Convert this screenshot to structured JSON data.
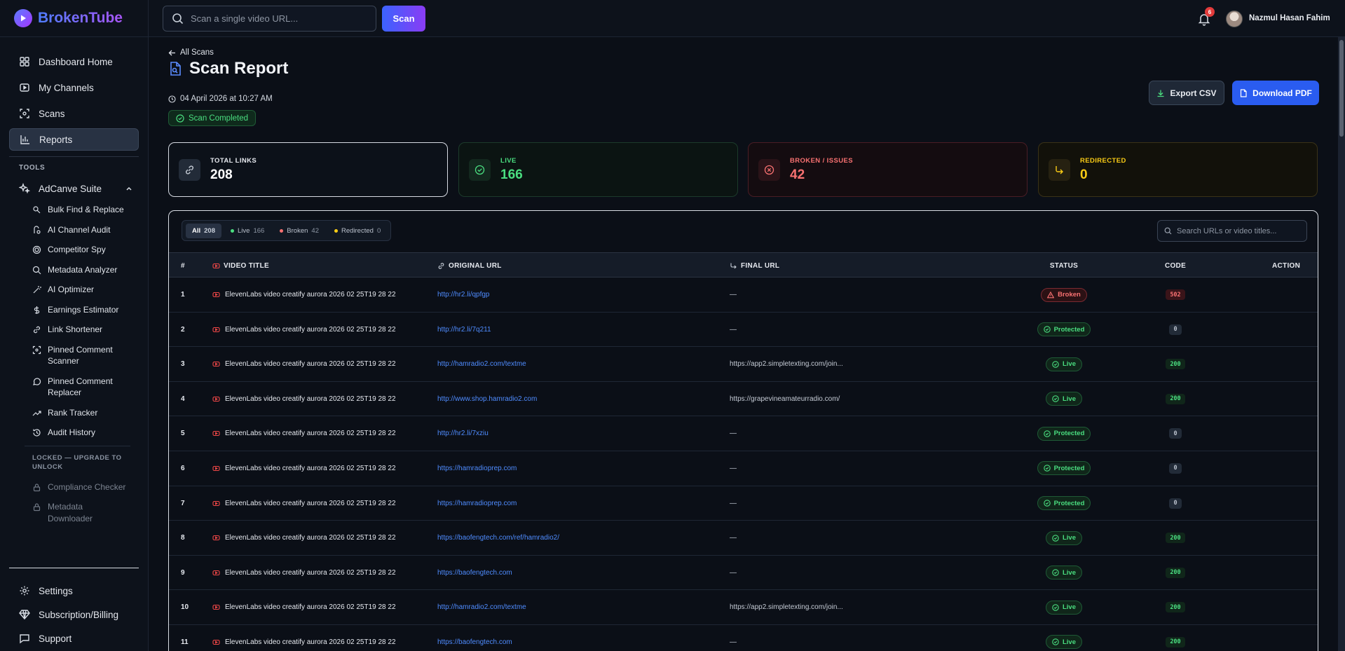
{
  "brand": {
    "name": "BrokenTube"
  },
  "topbar": {
    "search_placeholder": "Scan a single video URL...",
    "scan_label": "Scan",
    "notification_count": "6",
    "user_name": "Nazmul Hasan Fahim"
  },
  "sidebar": {
    "nav": [
      {
        "label": "Dashboard Home",
        "icon": "grid-icon"
      },
      {
        "label": "My Channels",
        "icon": "play-square-icon"
      },
      {
        "label": "Scans",
        "icon": "scan-icon"
      },
      {
        "label": "Reports",
        "icon": "bar-chart-icon",
        "active": true
      }
    ],
    "tools_heading": "TOOLS",
    "suite_label": "AdCanve Suite",
    "tools": [
      {
        "label": "Bulk Find & Replace"
      },
      {
        "label": "AI Channel Audit"
      },
      {
        "label": "Competitor Spy"
      },
      {
        "label": "Metadata Analyzer"
      },
      {
        "label": "AI Optimizer"
      },
      {
        "label": "Earnings Estimator"
      },
      {
        "label": "Link Shortener"
      },
      {
        "label": "Pinned Comment Scanner"
      },
      {
        "label": "Pinned Comment Replacer"
      },
      {
        "label": "Rank Tracker"
      },
      {
        "label": "Audit History"
      }
    ],
    "locked_heading": "LOCKED — UPGRADE TO UNLOCK",
    "locked_tools": [
      {
        "label": "Compliance Checker"
      },
      {
        "label": "Metadata Downloader"
      }
    ],
    "bottom": [
      {
        "label": "Settings"
      },
      {
        "label": "Subscription/Billing"
      },
      {
        "label": "Support"
      }
    ]
  },
  "page": {
    "back_label": "All Scans",
    "title": "Scan Report",
    "date": "04 April 2026 at 10:27 AM",
    "status": "Scan Completed",
    "export_csv": "Export CSV",
    "download_pdf": "Download PDF"
  },
  "stats": {
    "total": {
      "label": "TOTAL LINKS",
      "value": "208"
    },
    "live": {
      "label": "LIVE",
      "value": "166"
    },
    "broken": {
      "label": "BROKEN / ISSUES",
      "value": "42"
    },
    "redirected": {
      "label": "REDIRECTED",
      "value": "0"
    }
  },
  "filters": [
    {
      "label": "All",
      "count": "208",
      "active": true
    },
    {
      "label": "Live",
      "count": "166",
      "dot": "#4ade80"
    },
    {
      "label": "Broken",
      "count": "42",
      "dot": "#f87171"
    },
    {
      "label": "Redirected",
      "count": "0",
      "dot": "#facc15"
    }
  ],
  "table": {
    "search_placeholder": "Search URLs or video titles...",
    "headers": {
      "num": "#",
      "title": "VIDEO TITLE",
      "url": "ORIGINAL URL",
      "final": "FINAL URL",
      "status": "STATUS",
      "code": "CODE",
      "action": "ACTION"
    },
    "rows": [
      {
        "n": "1",
        "title": "ElevenLabs video creatify aurora 2026 02 25T19 28 22",
        "url": "http://hr2.li/qpfgp",
        "final": "—",
        "status": "Broken",
        "code": "502"
      },
      {
        "n": "2",
        "title": "ElevenLabs video creatify aurora 2026 02 25T19 28 22",
        "url": "http://hr2.li/7q211",
        "final": "—",
        "status": "Protected",
        "code": "0"
      },
      {
        "n": "3",
        "title": "ElevenLabs video creatify aurora 2026 02 25T19 28 22",
        "url": "http://hamradio2.com/textme",
        "final": "https://app2.simpletexting.com/join...",
        "status": "Live",
        "code": "200"
      },
      {
        "n": "4",
        "title": "ElevenLabs video creatify aurora 2026 02 25T19 28 22",
        "url": "http://www.shop.hamradio2.com",
        "final": "https://grapevineamateurradio.com/",
        "status": "Live",
        "code": "200"
      },
      {
        "n": "5",
        "title": "ElevenLabs video creatify aurora 2026 02 25T19 28 22",
        "url": "http://hr2.li/7xziu",
        "final": "—",
        "status": "Protected",
        "code": "0"
      },
      {
        "n": "6",
        "title": "ElevenLabs video creatify aurora 2026 02 25T19 28 22",
        "url": "https://hamradioprep.com",
        "final": "—",
        "status": "Protected",
        "code": "0"
      },
      {
        "n": "7",
        "title": "ElevenLabs video creatify aurora 2026 02 25T19 28 22",
        "url": "https://hamradioprep.com",
        "final": "—",
        "status": "Protected",
        "code": "0"
      },
      {
        "n": "8",
        "title": "ElevenLabs video creatify aurora 2026 02 25T19 28 22",
        "url": "https://baofengtech.com/ref/hamradio2/",
        "final": "—",
        "status": "Live",
        "code": "200"
      },
      {
        "n": "9",
        "title": "ElevenLabs video creatify aurora 2026 02 25T19 28 22",
        "url": "https://baofengtech.com",
        "final": "—",
        "status": "Live",
        "code": "200"
      },
      {
        "n": "10",
        "title": "ElevenLabs video creatify aurora 2026 02 25T19 28 22",
        "url": "http://hamradio2.com/textme",
        "final": "https://app2.simpletexting.com/join...",
        "status": "Live",
        "code": "200"
      },
      {
        "n": "11",
        "title": "ElevenLabs video creatify aurora 2026 02 25T19 28 22",
        "url": "https://baofengtech.com",
        "final": "—",
        "status": "Live",
        "code": "200"
      }
    ]
  }
}
